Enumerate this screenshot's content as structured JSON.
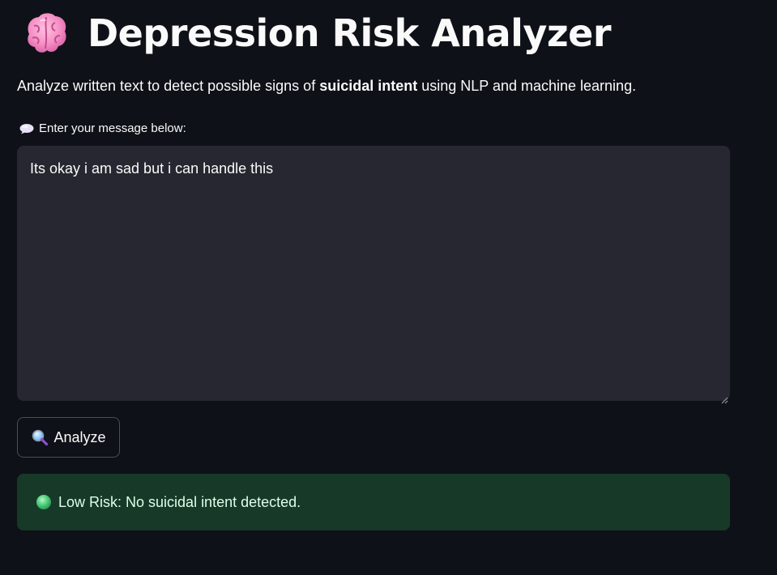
{
  "header": {
    "title": "Depression Risk Analyzer",
    "icon": "brain-icon"
  },
  "intro": {
    "prefix": "Analyze written text to detect possible signs of ",
    "emphasis": "suicidal intent",
    "suffix": " using NLP and machine learning."
  },
  "message_input": {
    "label": "Enter your message below:",
    "label_icon": "speech-bubble-icon",
    "value": "Its okay i am sad but i can handle this"
  },
  "analyze_button": {
    "label": "Analyze",
    "icon": "magnifier-icon"
  },
  "result": {
    "icon": "green-circle-icon",
    "text": "Low Risk: No suicidal intent detected.",
    "status_color": "#173928"
  },
  "colors": {
    "background": "#0e1117",
    "input_background": "#262730",
    "success_background": "#173928",
    "success_text": "#dffde9"
  }
}
